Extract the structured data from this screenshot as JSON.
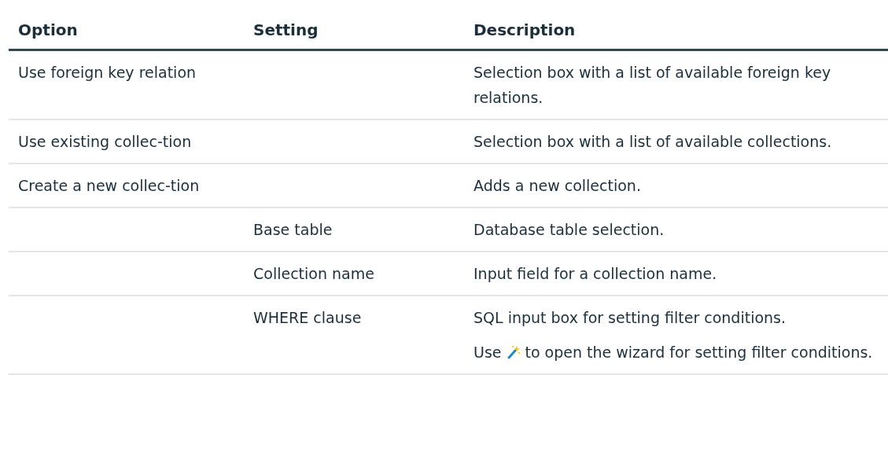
{
  "table": {
    "columns": [
      "Option",
      "Setting",
      "Description"
    ],
    "rows": [
      {
        "option": "Use foreign key relation",
        "setting": "",
        "description": [
          {
            "kind": "text",
            "text": "Selection box with a list of available foreign key relations."
          }
        ]
      },
      {
        "option": "Use existing collec-tion",
        "setting": "",
        "description": [
          {
            "kind": "text",
            "text": "Selection box with a list of available collections."
          }
        ]
      },
      {
        "option": "Create a new collec-tion",
        "setting": "",
        "description": [
          {
            "kind": "text",
            "text": "Adds a new collection."
          }
        ]
      },
      {
        "option": "",
        "setting": "Base table",
        "description": [
          {
            "kind": "text",
            "text": "Database table selection."
          }
        ]
      },
      {
        "option": "",
        "setting": "Collection name",
        "description": [
          {
            "kind": "text",
            "text": "Input field for a collection name."
          }
        ]
      },
      {
        "option": "",
        "setting": "WHERE clause",
        "description": [
          {
            "kind": "text",
            "text": "SQL input box for setting filter conditions."
          },
          {
            "kind": "icon_text",
            "before": "Use",
            "after": "to open the wizard for setting filter conditions."
          }
        ]
      }
    ]
  }
}
